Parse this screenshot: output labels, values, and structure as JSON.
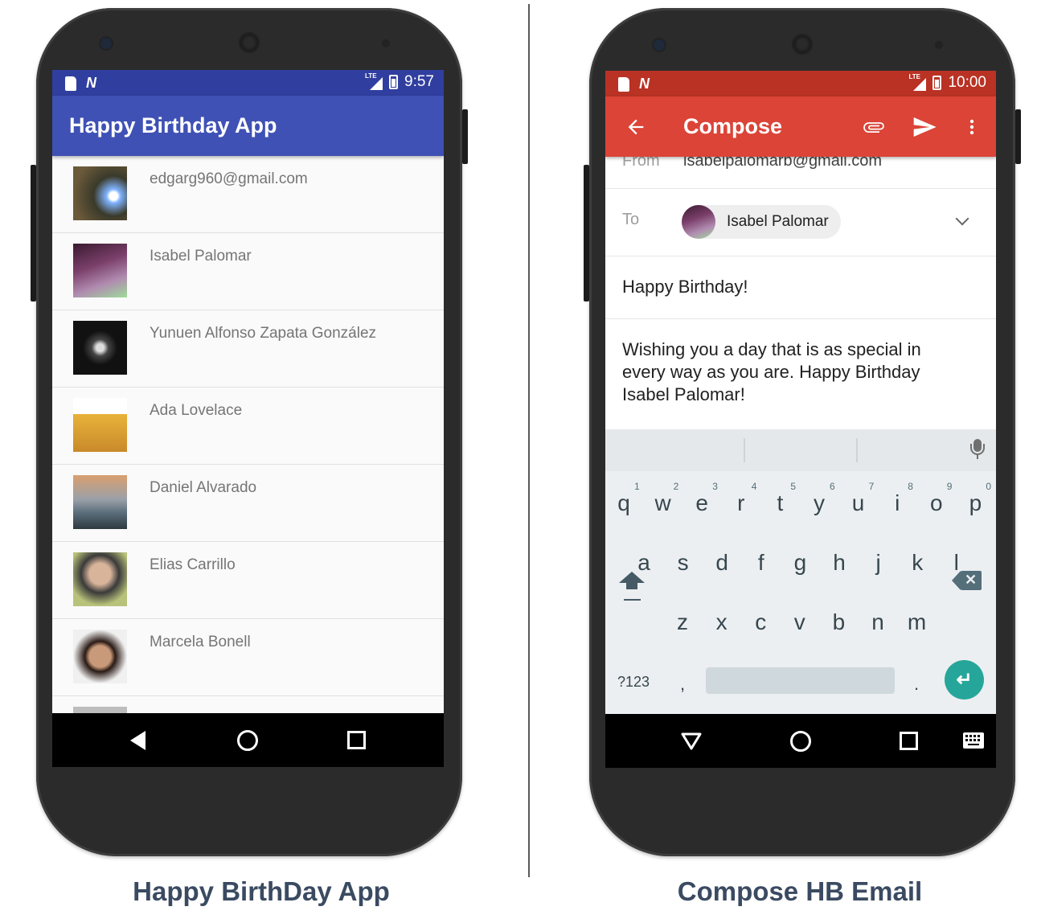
{
  "left_phone": {
    "status": {
      "time": "9:57"
    },
    "app_title": "Happy Birthday App",
    "contacts": [
      {
        "name": "edgarg960@gmail.com",
        "avatar_color": "#6b5a3a"
      },
      {
        "name": "Isabel Palomar",
        "avatar_color": "#7a3f6a"
      },
      {
        "name": "Yunuen Alfonso Zapata González",
        "avatar_color": "#111111"
      },
      {
        "name": "Ada Lovelace",
        "avatar_color": "#e8b23a"
      },
      {
        "name": "Daniel Alvarado",
        "avatar_color": "#8a8f96"
      },
      {
        "name": "Elias Carrillo",
        "avatar_color": "#9aa36a"
      },
      {
        "name": "Marcela Bonell",
        "avatar_color": "#b58a6a"
      }
    ],
    "primary_color": "#3f51b5",
    "status_color": "#303f9f"
  },
  "right_phone": {
    "status": {
      "time": "10:00"
    },
    "app_title": "Compose",
    "from_label": "From",
    "from_value": "isabelpalomarb@gmail.com",
    "to_label": "To",
    "to_chip": "Isabel Palomar",
    "subject": "Happy Birthday!",
    "body": "Wishing you a day that is as special in every way as you are. Happy Birthday Isabel Palomar!",
    "keyboard": {
      "row1": [
        "q",
        "w",
        "e",
        "r",
        "t",
        "y",
        "u",
        "i",
        "o",
        "p"
      ],
      "row1_nums": [
        "1",
        "2",
        "3",
        "4",
        "5",
        "6",
        "7",
        "8",
        "9",
        "0"
      ],
      "row2": [
        "a",
        "s",
        "d",
        "f",
        "g",
        "h",
        "j",
        "k",
        "l"
      ],
      "row3": [
        "z",
        "x",
        "c",
        "v",
        "b",
        "n",
        "m"
      ],
      "symbols_key": "?123",
      "comma_key": ",",
      "period_key": "."
    },
    "primary_color": "#db4437",
    "status_color": "#b93224",
    "accent_color": "#26a69a"
  },
  "captions": {
    "left": "Happy BirthDay App",
    "right": "Compose HB Email"
  }
}
